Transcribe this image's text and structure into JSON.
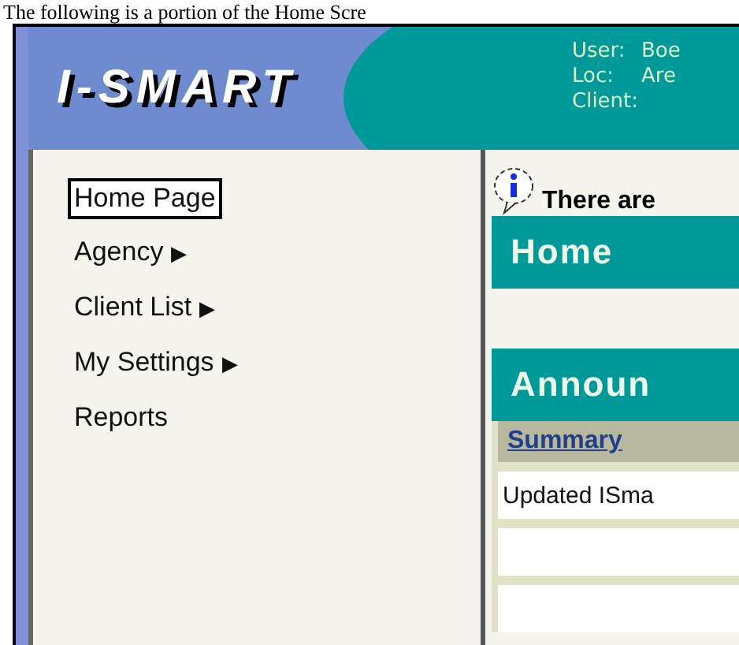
{
  "caption": "The following is a portion of the Home Scre",
  "header": {
    "logo": "I-SMART",
    "info": [
      {
        "label": "User:",
        "value": "Boe"
      },
      {
        "label": "Loc:",
        "value": "Are"
      },
      {
        "label": "Client:"
      }
    ]
  },
  "menu": [
    {
      "label": "Home Page",
      "selected": true,
      "submenu": false
    },
    {
      "label": "Agency",
      "selected": false,
      "submenu": true
    },
    {
      "label": "Client List",
      "selected": false,
      "submenu": true
    },
    {
      "label": "My Settings",
      "selected": false,
      "submenu": true
    },
    {
      "label": "Reports",
      "selected": false,
      "submenu": false
    }
  ],
  "submenu_arrow": "▶",
  "notice": "There are",
  "home_banner": "Home",
  "announcements": {
    "title": "Announ",
    "columns": [
      "Summary"
    ],
    "rows": [
      [
        "Updated ISma"
      ],
      [
        ""
      ],
      [
        ""
      ]
    ]
  }
}
